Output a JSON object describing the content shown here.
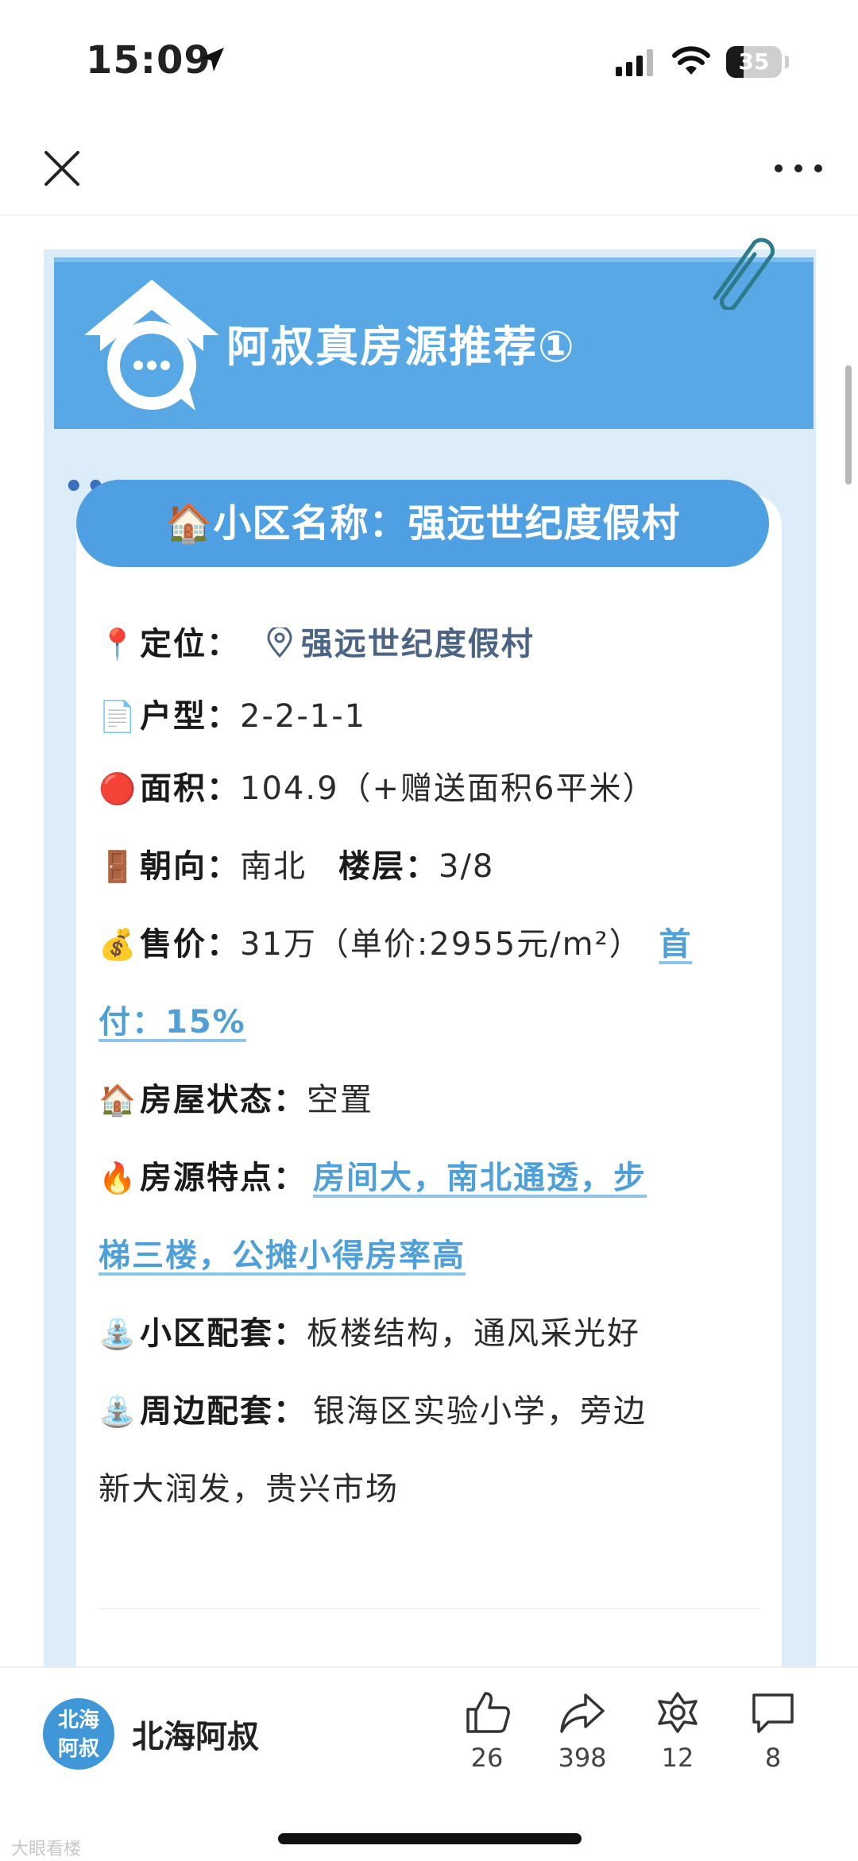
{
  "status_bar": {
    "time": "15:09",
    "battery": "35"
  },
  "header": {
    "title": "阿叔真房源推荐①"
  },
  "community": {
    "label": "🏠小区名称：强远世纪度假村"
  },
  "info": {
    "location": {
      "emoji": "📍",
      "key": "定位：",
      "value": "强远世纪度假村"
    },
    "layout": {
      "emoji": "📄",
      "key": "户型：",
      "value": "2-2-1-1"
    },
    "area": {
      "emoji": "🔴",
      "key": "面积：",
      "value": "104.9（+赠送面积6平米）"
    },
    "orientation": {
      "emoji": "🚪",
      "key": "朝向：",
      "value": "南北",
      "floor_key": "楼层：",
      "floor_value": "3/8"
    },
    "price": {
      "emoji": "💰",
      "key": "售价：",
      "value": "31万（单价:2955元/m²）",
      "down_payment_a": "首",
      "down_payment_b": "付：15%"
    },
    "status": {
      "emoji": "🏠",
      "key": "房屋状态：",
      "value": "空置"
    },
    "features": {
      "emoji": "🔥",
      "key": "房源特点：",
      "line1": "房间大，南北通透，步",
      "line2": "梯三楼，公摊小得房率高"
    },
    "community_facilities": {
      "emoji": "⛲",
      "key": "小区配套：",
      "value": "板楼结构，通风采光好"
    },
    "surroundings": {
      "emoji": "⛲",
      "key": "周边配套：",
      "line1": "银海区实验小学，旁边",
      "line2": "新大润发，贵兴市场"
    }
  },
  "author": {
    "avatar_text_1": "北海",
    "avatar_text_2": "阿叔",
    "name": "北海阿叔"
  },
  "actions": {
    "like": "26",
    "share": "398",
    "collect": "12",
    "comment": "8"
  },
  "watermark": "大眼看楼",
  "colors": {
    "accent": "#4ea0e2",
    "link": "#4f9fd8",
    "banner": "#58a8e6"
  }
}
